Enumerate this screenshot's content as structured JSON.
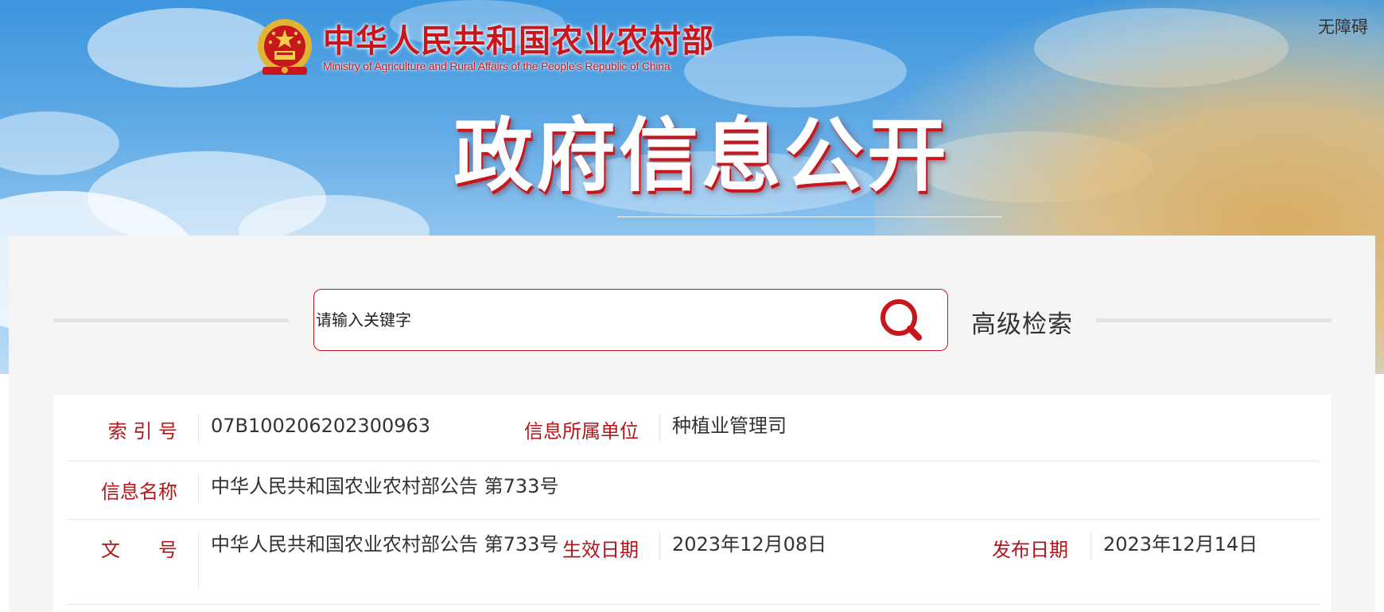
{
  "header": {
    "accessibility_label": "无障碍",
    "site_name_cn": "中华人民共和国农业农村部",
    "site_name_en": "Ministry of Agriculture and Rural Affairs of the People's Republic of China",
    "banner_title": "政府信息公开",
    "emblem_icon": "national-emblem-icon",
    "brand_color": "#c8161d"
  },
  "search": {
    "placeholder": "请输入关键字",
    "search_icon": "search-icon",
    "advanced_label": "高级检索"
  },
  "info": {
    "index_no_label": "索 引 号",
    "index_no_value": "07B100206202300963",
    "org_label": "信息所属单位",
    "org_value": "种植业管理司",
    "name_label": "信息名称",
    "name_value": "中华人民共和国农业农村部公告 第733号",
    "doc_no_label": "文　　号",
    "doc_no_value": "中华人民共和国农业农村部公告 第733号",
    "effective_label": "生效日期",
    "effective_value": "2023年12月08日",
    "publish_label": "发布日期",
    "publish_value": "2023年12月14日"
  }
}
